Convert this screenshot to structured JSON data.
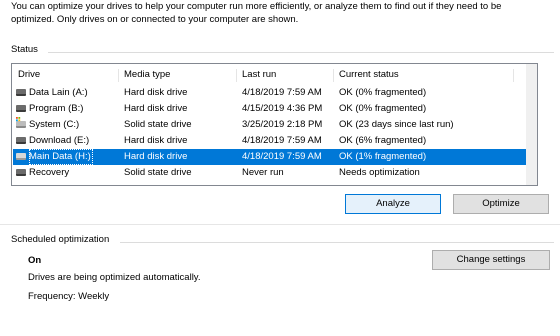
{
  "intro": {
    "line1": "You can optimize your drives to help your computer run more efficiently, or analyze them to find out if they need to be",
    "line2": "optimized. Only drives on or connected to your computer are shown."
  },
  "status": {
    "label": "Status",
    "columns": [
      "Drive",
      "Media type",
      "Last run",
      "Current status"
    ],
    "rows": [
      {
        "drive": "Data Lain (A:)",
        "media": "Hard disk drive",
        "last_run": "4/18/2019 7:59 AM",
        "status": "OK (0% fragmented)",
        "icon": "hard-drive-icon"
      },
      {
        "drive": "Program (B:)",
        "media": "Hard disk drive",
        "last_run": "4/15/2019 4:36 PM",
        "status": "OK (0% fragmented)",
        "icon": "hard-drive-icon"
      },
      {
        "drive": "System (C:)",
        "media": "Solid state drive",
        "last_run": "3/25/2019 2:18 PM",
        "status": "OK (23 days since last run)",
        "icon": "system-drive-icon"
      },
      {
        "drive": "Download (E:)",
        "media": "Hard disk drive",
        "last_run": "4/18/2019 7:59 AM",
        "status": "OK (6% fragmented)",
        "icon": "hard-drive-icon"
      },
      {
        "drive": "Main Data (H:)",
        "media": "Hard disk drive",
        "last_run": "4/18/2019 7:59 AM",
        "status": "OK (1% fragmented)",
        "icon": "hard-drive-icon",
        "selected": true
      },
      {
        "drive": "Recovery",
        "media": "Solid state drive",
        "last_run": "Never run",
        "status": "Needs optimization",
        "icon": "hard-drive-icon"
      }
    ],
    "analyze_label": "Analyze",
    "optimize_label": "Optimize"
  },
  "scheduled": {
    "label": "Scheduled optimization",
    "state": "On",
    "description": "Drives are being optimized automatically.",
    "frequency": "Frequency: Weekly",
    "change_label": "Change settings"
  },
  "colors": {
    "selection": "#0078d7",
    "primary_button_border": "#0078d7"
  }
}
